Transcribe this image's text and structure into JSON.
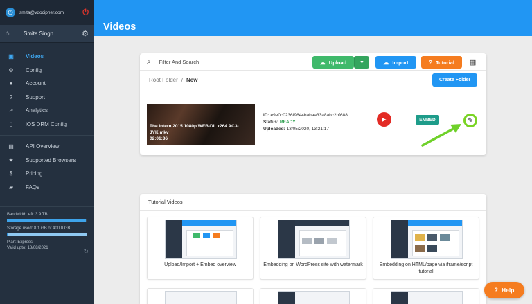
{
  "account": {
    "email": "smita@vdocipher.com",
    "user_name": "Smita Singh"
  },
  "sidebar": {
    "primary": [
      {
        "label": "Videos",
        "icon": "video-icon",
        "active": true
      },
      {
        "label": "Config",
        "icon": "gear-icon"
      },
      {
        "label": "Account",
        "icon": "user-icon"
      },
      {
        "label": "Support",
        "icon": "help-icon"
      },
      {
        "label": "Analytics",
        "icon": "analytics-icon"
      },
      {
        "label": "iOS DRM Config",
        "icon": "phone-icon"
      }
    ],
    "secondary": [
      {
        "label": "API Overview",
        "icon": "api-icon"
      },
      {
        "label": "Supported Browsers",
        "icon": "star-icon"
      },
      {
        "label": "Pricing",
        "icon": "dollar-icon"
      },
      {
        "label": "FAQs",
        "icon": "chat-icon"
      }
    ],
    "bandwidth_label": "Bandwidth left: 3.9 TB",
    "bandwidth_fraction": 0.99,
    "storage_label": "Storage used: 8.1 GB of 400.0 GB",
    "storage_fraction": 0.02,
    "plan": "Plan: Express",
    "valid": "Valid upto: 18/08/2021"
  },
  "header": {
    "title": "Videos"
  },
  "toolbar": {
    "search_placeholder": "Filter And Search",
    "upload_label": "Upload",
    "import_label": "Import",
    "tutorial_label": "Tutorial"
  },
  "breadcrumb": {
    "root": "Root Folder",
    "sep": "/",
    "current": "New"
  },
  "create_folder_label": "Create Folder",
  "video": {
    "title": "The Intern 2015 1080p WEB-DL x264 AC3-JYK.mkv",
    "duration": "02:01:36",
    "id_label": "ID:",
    "id": "e9e0c0236f9644babaa33a8abc2bf688",
    "status_label": "Status:",
    "status": "READY",
    "uploaded_label": "Uploaded:",
    "uploaded": "13/05/2020, 13:21:17",
    "embed_label": "EMBED"
  },
  "tutorials": {
    "title": "Tutorial Videos",
    "items": [
      {
        "label": "Upload/Import + Embed overview"
      },
      {
        "label": "Embedding on WordPress site with watermark"
      },
      {
        "label": "Embedding on HTML/page via iframe/script tutorial"
      }
    ]
  },
  "help_label": "Help"
}
